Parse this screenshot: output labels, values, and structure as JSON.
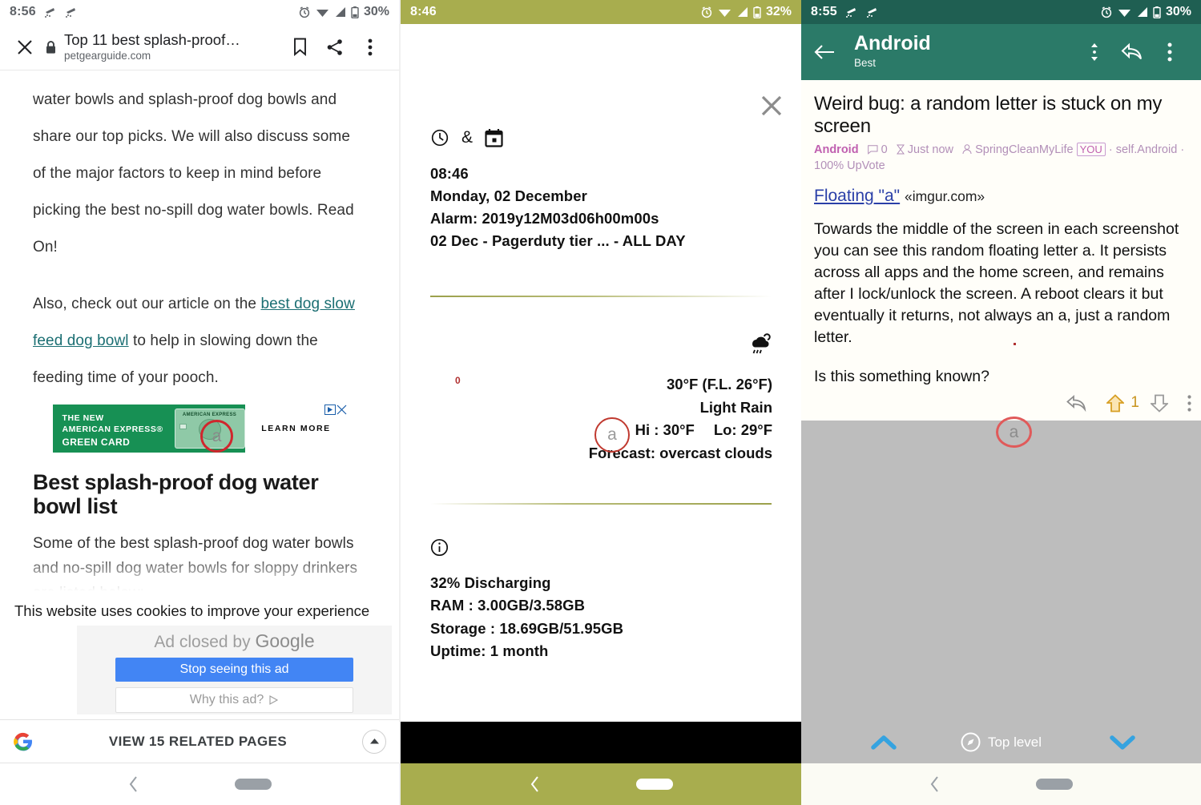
{
  "panel1": {
    "statusbar": {
      "time": "8:56",
      "battery": "30%",
      "icons": [
        "cloud-rain-icon",
        "cloud-rain-icon",
        "alarm-icon",
        "wifi-icon",
        "signal-icon",
        "battery-icon"
      ]
    },
    "browser": {
      "title": "Top 11 best splash-proof…",
      "host": "petgearguide.com",
      "close_label": "Close",
      "bookmark_label": "Bookmark",
      "share_label": "Share",
      "menu_label": "More options"
    },
    "article": {
      "para1": "water bowls and splash-proof dog bowls and share our top picks. We will also discuss some of the major factors to keep in mind before picking the best no-spill dog water bowls. Read On!",
      "para2_pre": "Also, check out our article on the ",
      "para2_link": "best dog slow feed dog bowl",
      "para2_post": " to help in slowing down the feeding time of your pooch.",
      "heading": "Best splash-proof dog water bowl list",
      "para3": "Some of the best splash-proof dog water bowls and no-spill dog water bowls for sloppy drinkers are listed below:"
    },
    "ad": {
      "line1": "THE NEW",
      "line2": "AMERICAN EXPRESS®",
      "line3": "GREEN CARD",
      "card_label": "AMERICAN EXPRESS",
      "cta": "LEARN MORE"
    },
    "cookie_notice": "This website uses cookies to improve your experience",
    "ad_closed": {
      "prefix": "Ad closed by ",
      "brand": "Google",
      "stop_button": "Stop seeing this ad",
      "why_button": "Why this ad?"
    },
    "google_bar": {
      "label": "VIEW 15 RELATED PAGES"
    },
    "floating_letter": "a"
  },
  "panel2": {
    "statusbar": {
      "time": "8:46",
      "battery": "32%"
    },
    "close_label": "Close",
    "clock_calendar": {
      "icons": "clock-icon & calendar-icon",
      "separator": "&",
      "time": "08:46",
      "date": "Monday, 02 December",
      "alarm": "Alarm: 2019y12M03d06h00m00s",
      "event": "02 Dec - Pagerduty tier ... - ALL DAY"
    },
    "weather": {
      "icon": "rain-cloud-icon",
      "temp": "30°F (F.L. 26°F)",
      "condition": "Light Rain",
      "hi": "Hi : 30°F",
      "lo": "Lo: 29°F",
      "forecast": "Forecast: overcast clouds",
      "marker": "0"
    },
    "system": {
      "icon": "info-icon",
      "battery": "32% Discharging",
      "ram": "RAM : 3.00GB/3.58GB",
      "storage": "Storage : 18.69GB/51.95GB",
      "uptime": "Uptime: 1 month"
    },
    "floating_letter": "a"
  },
  "panel3": {
    "statusbar": {
      "time": "8:55",
      "battery": "30%"
    },
    "appbar": {
      "title": "Android",
      "subtitle": "Best",
      "back_label": "Back",
      "sort_label": "Sort",
      "reply_label": "Reply",
      "menu_label": "More options"
    },
    "post": {
      "title": "Weird bug: a random letter is stuck on my screen",
      "subreddit": "Android",
      "comments": "0",
      "time": "Just now",
      "author": "SpringCleanMyLife",
      "you_badge": "YOU",
      "domain": "self.Android",
      "upvote_ratio": "100% UpVote",
      "link_text": "Floating \"a\"",
      "link_host": "«imgur.com»",
      "body_p1": "Towards the middle of the screen in each screenshot you can see this random floating letter a. It persists across all apps and the home screen, and remains after I lock/unlock the screen. A reboot clears it but eventually it returns, not always an a, just a random letter.",
      "body_p2": "Is this something known?",
      "vote_count": "1"
    },
    "bottombar": {
      "label": "Top level",
      "icon": "compass-icon"
    },
    "floating_letter": "a"
  },
  "colors": {
    "status_olive": "#a8ad4e",
    "status_teal_dark": "#1f5f52",
    "appbar_teal": "#2b7a68",
    "link_blue": "#2a3fa8",
    "upvote_gold": "#c8941f",
    "marker_red": "#d0262d",
    "google_blue": "#4285f4",
    "amex_green": "#179054"
  }
}
